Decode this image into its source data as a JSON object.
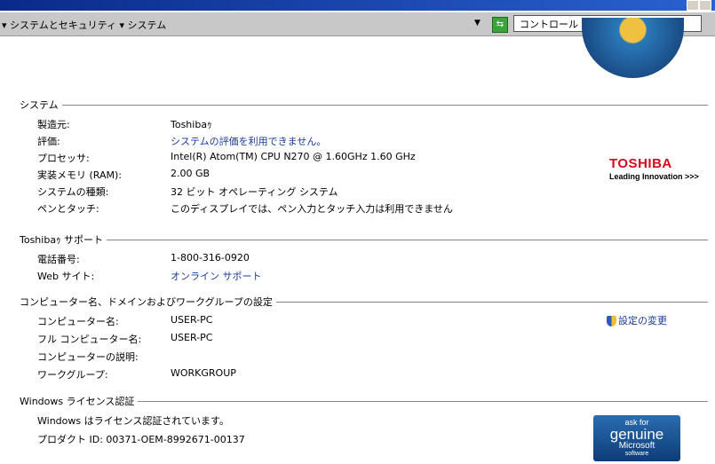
{
  "address": {
    "breadcrumb": "▾ システムとセキュリティ ▾ システム",
    "search_placeholder": "コントロール パネルの検索"
  },
  "sections": {
    "system": {
      "title": "システム",
      "rows": [
        {
          "label": "製造元:",
          "value": "Toshibaｩ"
        },
        {
          "label": "評価:",
          "value": "システムの評価を利用できません。"
        },
        {
          "label": "プロセッサ:",
          "value": "Intel(R) Atom(TM) CPU N270  @ 1.60GHz   1.60 GHz"
        },
        {
          "label": "実装メモリ (RAM):",
          "value": "2.00 GB"
        },
        {
          "label": "システムの種類:",
          "value": "32 ビット オペレーティング システム"
        },
        {
          "label": "ペンとタッチ:",
          "value": "このディスプレイでは、ペン入力とタッチ入力は利用できません"
        }
      ]
    },
    "support": {
      "title": "Toshibaｩ サポート",
      "rows": [
        {
          "label": "電話番号:",
          "value": "1-800-316-0920"
        },
        {
          "label": "Web サイト:",
          "value": "オンライン サポート"
        }
      ]
    },
    "computer": {
      "title": "コンピューター名、ドメインおよびワークグループの設定",
      "change": "設定の変更",
      "rows": [
        {
          "label": "コンピューター名:",
          "value": "USER-PC"
        },
        {
          "label": "フル コンピューター名:",
          "value": "USER-PC"
        },
        {
          "label": "コンピューターの説明:",
          "value": ""
        },
        {
          "label": "ワークグループ:",
          "value": "WORKGROUP"
        }
      ]
    },
    "license": {
      "title": "Windows ライセンス認証",
      "status": "Windows はライセンス認証されています。",
      "product_id": "プロダクト ID: 00371-OEM-8992671-00137"
    }
  },
  "oem": {
    "brand": "TOSHIBA",
    "tagline": "Leading Innovation >>>"
  },
  "genuine": {
    "l1": "ask for",
    "l2": "genuine",
    "l3": "Microsoft",
    "l4": "software"
  }
}
